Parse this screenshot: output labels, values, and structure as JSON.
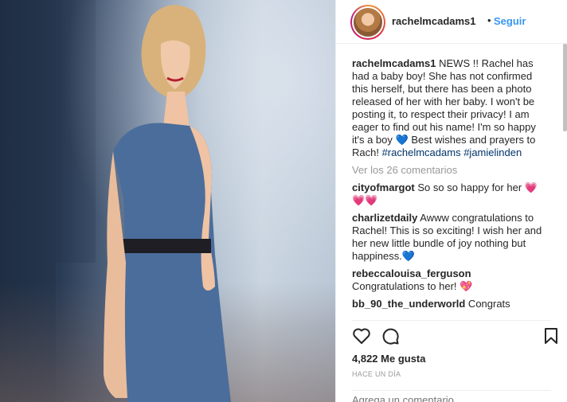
{
  "post": {
    "username": "rachelmcadams1",
    "dot": "•",
    "follow_label": "Seguir"
  },
  "caption": {
    "username": "rachelmcadams1",
    "text": " NEWS !! Rachel has had a baby boy! She has not confirmed this herself, but there has been a photo released of her with her baby. I won't be posting it, to respect their privacy! I am eager to find out his name! I'm so happy it's a boy ",
    "emoji": "💙",
    "text_end": " Best wishes and prayers to Rach! ",
    "tag1": "#rachelmcadams",
    "tag2": "#jamielinden"
  },
  "view_all": "Ver los 26 comentarios",
  "comments": [
    {
      "user": "cityofmargot",
      "text": " So so so happy for her ",
      "emoji": "💗💗💗"
    },
    {
      "user": "charlizetdaily",
      "text": " Awww congratulations to Rachel! This is so exciting! I wish her and her new little bundle of joy nothing but happiness.",
      "emoji": "💙"
    },
    {
      "user": "rebeccalouisa_ferguson",
      "text": " Congratulations to her! ",
      "emoji": "💖"
    },
    {
      "user": "bb_90_the_underworld",
      "text": " Congrats",
      "emoji": ""
    }
  ],
  "likes": "4,822 Me gusta",
  "time": "HACE UN DÍA",
  "add_comment_placeholder": "Agrega un comentario...",
  "icons": {
    "like": "heart-outline-icon",
    "comment": "speech-bubble-icon",
    "save": "bookmark-icon"
  },
  "colors": {
    "link": "#3897f0",
    "hashtag": "#003569",
    "muted": "#999999",
    "heart": "#c8102e",
    "teal_heart": "#00a5b5"
  }
}
